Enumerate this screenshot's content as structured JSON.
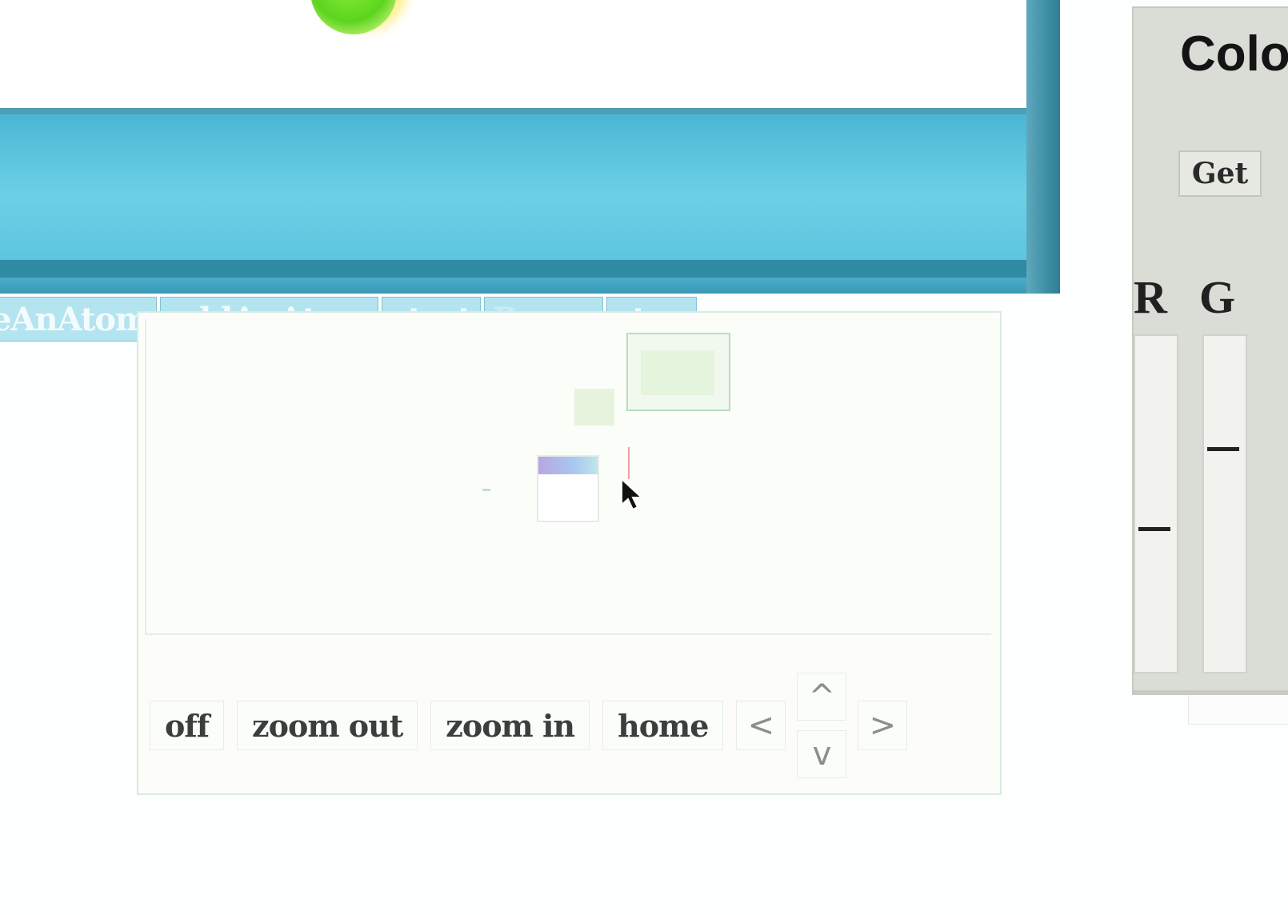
{
  "world": {
    "toolbar": [
      {
        "label": "eAnAtom",
        "faded": false
      },
      {
        "label": "addAnAtom",
        "faded": false
      },
      {
        "label": "start",
        "faded": false
      },
      {
        "label": "Pause",
        "faded": true
      },
      {
        "label": "stop",
        "faded": false
      }
    ]
  },
  "navigator": {
    "buttons": {
      "off": "off",
      "zoom_out": "zoom out",
      "zoom_in": "zoom in",
      "home": "home",
      "left": "<",
      "up": "^",
      "down": "v",
      "right": ">"
    }
  },
  "color_panel": {
    "title": "Colo",
    "get_label": "Get",
    "channels": [
      {
        "label": "R",
        "level": 0.57
      },
      {
        "label": "G",
        "level": 0.33
      }
    ]
  },
  "icons": [
    "cursor-icon",
    "green-atom"
  ]
}
